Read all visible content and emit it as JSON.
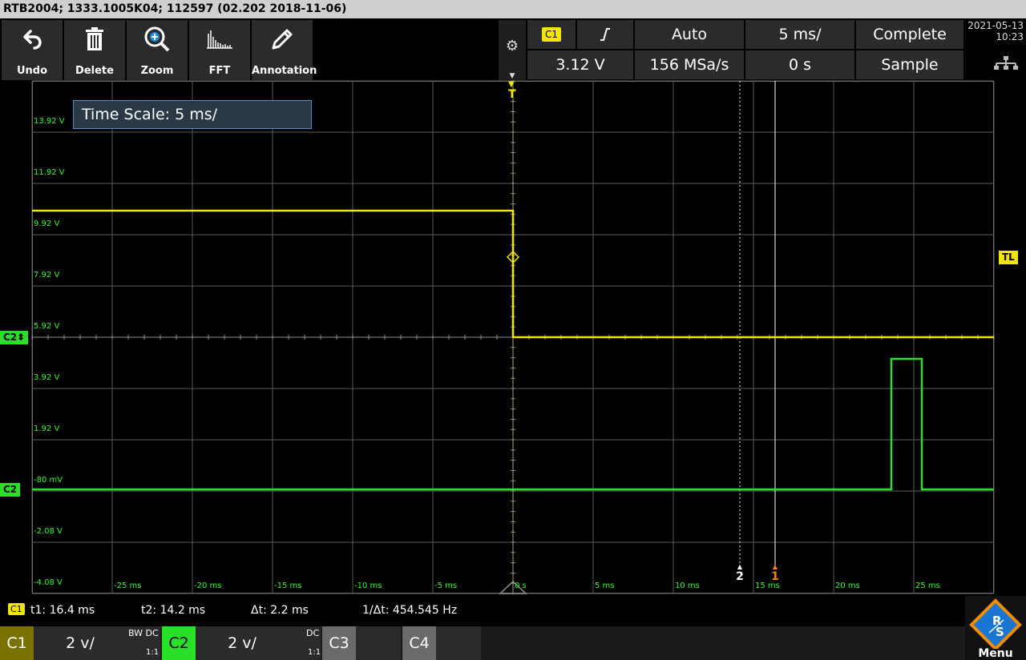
{
  "title": "RTB2004; 1333.1005K04; 112597 (02.202 2018-11-06)",
  "toolbar": {
    "buttons": [
      {
        "label": "Undo",
        "icon": "undo-icon"
      },
      {
        "label": "Delete",
        "icon": "trash-icon"
      },
      {
        "label": "Zoom",
        "icon": "zoom-icon"
      },
      {
        "label": "FFT",
        "icon": "fft-icon"
      },
      {
        "label": "Annotation",
        "icon": "pencil-icon"
      }
    ]
  },
  "trigger": {
    "source": "C1",
    "edge_icon": "rising-edge-icon",
    "mode": "Auto",
    "timebase": "5 ms/",
    "acq_state": "Complete",
    "level": "3.12 V",
    "sample_rate": "156 MSa/s",
    "position": "0 s",
    "acq_mode": "Sample"
  },
  "datetime": {
    "date": "2021-05-13",
    "time": "10:23"
  },
  "plot": {
    "time_scale_popup": "Time Scale: 5 ms/",
    "voltage_labels": [
      "13.92 V",
      "11.92 V",
      "9.92 V",
      "7.92 V",
      "5.92 V",
      "3.92 V",
      "1.92 V",
      "-80 mV",
      "-2.08 V",
      "-4.08 V"
    ],
    "time_labels": [
      "-25 ms",
      "-20 ms",
      "-15 ms",
      "-10 ms",
      "-5 ms",
      "0 s",
      "5 ms",
      "10 ms",
      "15 ms",
      "20 ms",
      "25 ms"
    ],
    "markers": {
      "c2_offset": "C2",
      "c2_ground": "C2",
      "trigger_level": "TL",
      "trigger_pos": "T"
    },
    "cursor_labels": [
      "2",
      "1"
    ],
    "colors": {
      "c1": "#f2e600",
      "c2": "#28e028",
      "grid": "#5a5a5a",
      "cursor2": "#ffffff",
      "cursor1": "#ff8000"
    }
  },
  "readout": {
    "source": "C1",
    "t1": "t1: 16.4 ms",
    "t2": "t2: 14.2 ms",
    "dt": "Δt: 2.2 ms",
    "inv_dt": "1/Δt: 454.545 Hz"
  },
  "channels": [
    {
      "name": "C1",
      "scale": "2 v/",
      "coupling_top": "BW DC",
      "coupling_bottom": "1:1"
    },
    {
      "name": "C2",
      "scale": "2 v/",
      "coupling_top": "DC",
      "coupling_bottom": "1:1"
    },
    {
      "name": "C3"
    },
    {
      "name": "C4"
    }
  ],
  "menu": {
    "label": "Menu",
    "logo": "rohde-schwarz-logo"
  }
}
